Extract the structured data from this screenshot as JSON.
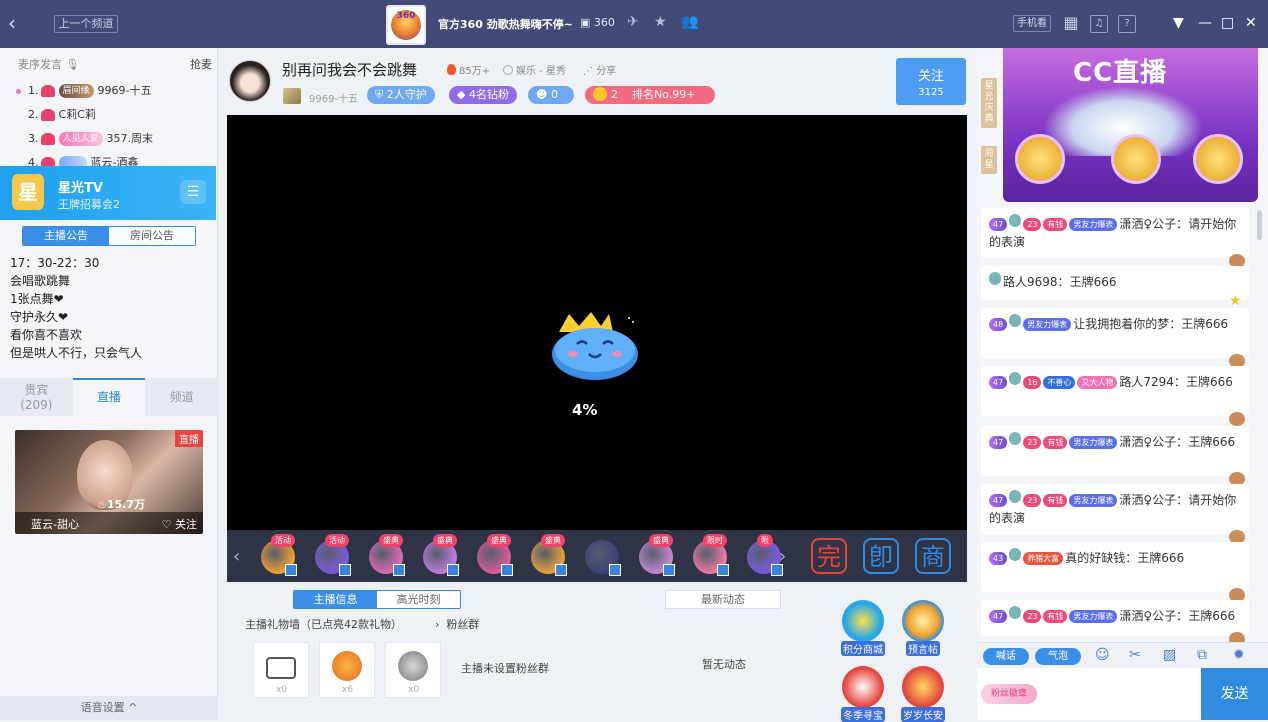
{
  "titlebar": {
    "back": "‹",
    "prev_channel": "上一个频道",
    "logo_text": "360",
    "channel_title": "官方360 劲歌热舞嗨不停~",
    "channel_id": "360",
    "phone_watch": "手机看",
    "window_controls": {
      "dropdown": "▼",
      "minimize": "—",
      "maximize": "□",
      "close": "✕"
    }
  },
  "left": {
    "rank_header": "麦序发言",
    "rank_grab": "抢麦",
    "rank_list": [
      {
        "no": "1.",
        "tag": "眉间缘",
        "name": "9969-十五"
      },
      {
        "no": "2.",
        "tag": "",
        "name": "C莉C莉"
      },
      {
        "no": "3.",
        "tag": "人见人爱",
        "name": "357.周末"
      },
      {
        "no": "4.",
        "tag": "",
        "name": "蓝云-酒鑫"
      }
    ],
    "star_card": {
      "avatar": "星",
      "name": "星光TV",
      "sub": "王牌招募会2",
      "menu": "☰"
    },
    "notice_tabs": [
      "主播公告",
      "房间公告"
    ],
    "notice_lines": [
      "17：30-22：30",
      "会唱歌跳舞",
      "1张点舞❤",
      "守护永久❤",
      "看你喜不喜欢",
      "但是哄人不行，只会气人"
    ],
    "bottom_tabs": [
      {
        "label": "贵宾",
        "count": "(209)"
      },
      {
        "label": "直播"
      },
      {
        "label": "频道"
      }
    ],
    "live_card": {
      "badge": "直播",
      "hot": "15.7万",
      "name": "蓝云-甜心",
      "follow": "关注"
    },
    "voice_settings": "语音设置 ^"
  },
  "center": {
    "anchor_name": "别再问我会不会跳舞",
    "hot_count": "85万+",
    "category": "娱乐 - 星秀",
    "share": "分享",
    "anchor_level": "9969-十五",
    "guard": "2人守护",
    "fans": "4名钻粉",
    "users": "0",
    "rank_stars": "2",
    "rank": "排名No.99+",
    "follow_label": "关注",
    "follow_count": "3125",
    "loading_percent": "4%",
    "gifts": [
      {
        "tag": "活动",
        "color": "#f2a12e"
      },
      {
        "tag": "活动",
        "color": "#7b5be0"
      },
      {
        "tag": "盛典",
        "color": "#e06bb8"
      },
      {
        "tag": "盛典",
        "color": "#c07de0"
      },
      {
        "tag": "盛典",
        "color": "#e25b9c"
      },
      {
        "tag": "盛典",
        "color": "#e8a23a"
      },
      {
        "tag": "",
        "color": "#3a3f7a"
      },
      {
        "tag": "盛典",
        "color": "#c78ad8"
      },
      {
        "tag": "限时",
        "color": "#f07aa8"
      },
      {
        "tag": "限",
        "color": "#7a5be8"
      }
    ],
    "big_buttons": [
      {
        "glyph": "完",
        "color": "#e2463d"
      },
      {
        "glyph": "卽",
        "color": "#2f8ae0"
      },
      {
        "glyph": "商",
        "color": "#2f8ae0"
      }
    ],
    "info_tabs": [
      "主播信息",
      "高光时刻"
    ],
    "news_button": "最新动态",
    "gift_wall": "主播礼物墙（已点亮42款礼物）",
    "fans_group_label": "粉丝群",
    "gift_wall_items": [
      {
        "count": "x0"
      },
      {
        "count": "x6"
      },
      {
        "count": "x0"
      }
    ],
    "no_fans_group": "主播未设置粉丝群",
    "no_news": "暂无动态",
    "actions": [
      "积分商城",
      "预言帖",
      "冬季寻宝",
      "岁岁长安"
    ]
  },
  "right": {
    "banner_cc": "CC直播",
    "side_tabs": [
      "星光庆典",
      "周星"
    ],
    "messages": [
      {
        "badges": [
          "47",
          "23",
          "有钱",
          "男友力爆表"
        ],
        "user": "潇洒♀公子",
        "text": "请开始你的表演",
        "end": "face"
      },
      {
        "badges": [],
        "user": "路人9698",
        "text": "王牌666",
        "end": "star"
      },
      {
        "badges": [
          "48",
          "男友力爆表"
        ],
        "user": "让我拥抱着你的梦",
        "text": "王牌666",
        "end": "face"
      },
      {
        "badges": [
          "47",
          "16",
          "不善心",
          "又大人物"
        ],
        "user": "路人7294",
        "text": "王牌666",
        "end": "face"
      },
      {
        "badges": [
          "47",
          "23",
          "有钱",
          "男友力爆表"
        ],
        "user": "潇洒♀公子",
        "text": "王牌666",
        "end": "face"
      },
      {
        "badges": [
          "47",
          "23",
          "有钱",
          "男友力爆表"
        ],
        "user": "潇洒♀公子",
        "text": "请开始你的表演",
        "end": "face"
      },
      {
        "badges": [
          "43",
          "养猪大富"
        ],
        "user": "真的好缺钱",
        "text": "王牌666",
        "end": "face"
      },
      {
        "badges": [
          "47",
          "23",
          "有钱",
          "男友力爆表"
        ],
        "user": "潇洒♀公子",
        "text": "王牌666",
        "end": "face"
      }
    ],
    "toolbar": {
      "shout": "喊话",
      "bubble": "气泡"
    },
    "input_badge": "粉丝徽章",
    "send": "发送"
  }
}
